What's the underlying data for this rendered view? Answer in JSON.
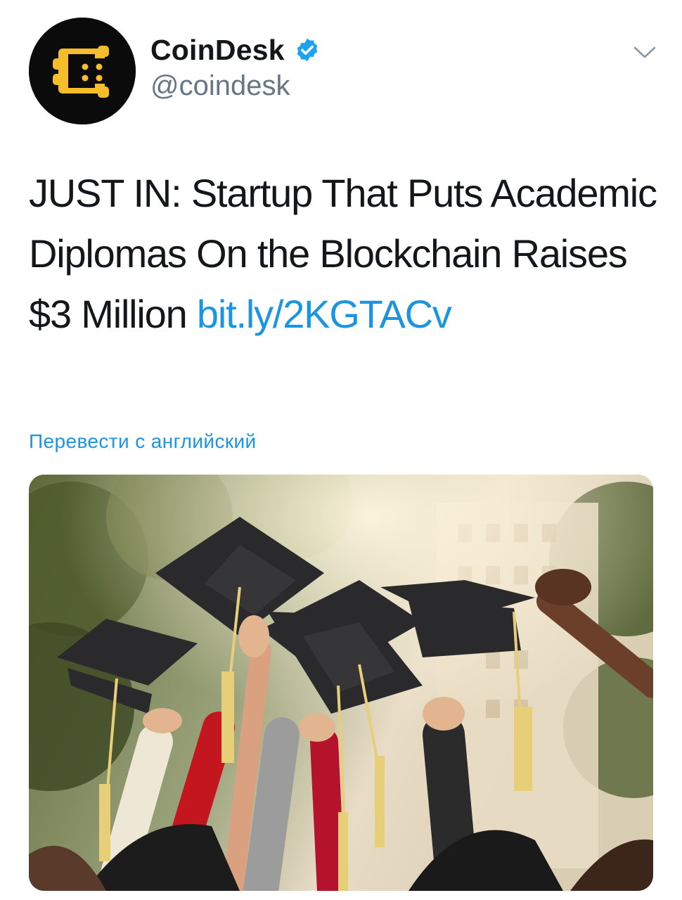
{
  "tweet": {
    "display_name": "CoinDesk",
    "handle": "@coindesk",
    "verified": true,
    "text_main": "JUST IN: Startup That Puts Academic Diplomas On the Blockchain Raises $3 Million ",
    "link_text": "bit.ly/2KGTACv",
    "translate_label": "Перевести с английский"
  },
  "icons": {
    "avatar": "coindesk-logo",
    "verified": "verified-badge-icon",
    "menu": "chevron-down-icon"
  },
  "colors": {
    "link": "#1b95e0",
    "verified": "#1da1f2",
    "logo_yellow": "#f5bd2a",
    "logo_bg": "#0b0b0b",
    "handle_gray": "#657786"
  },
  "media": {
    "subject": "graduation caps thrown in the air"
  }
}
